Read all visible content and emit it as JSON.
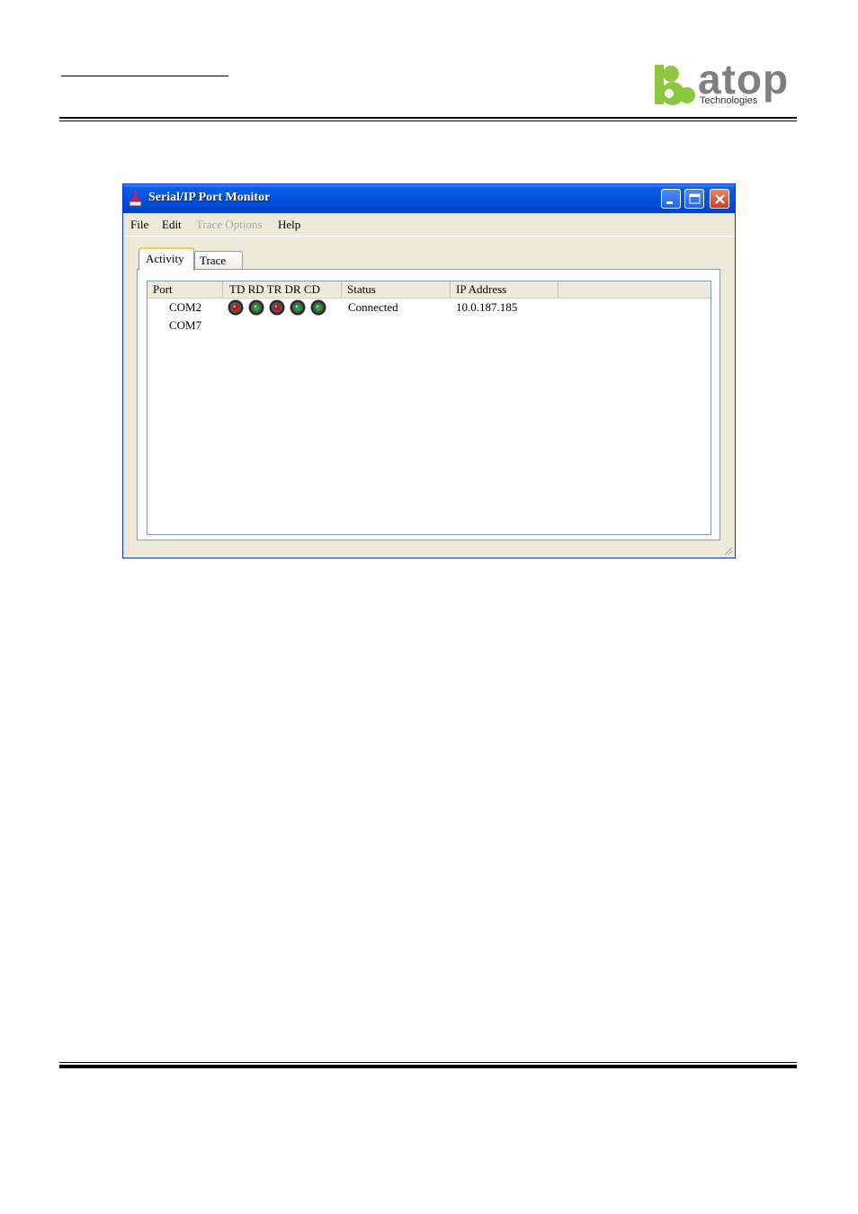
{
  "logo": {
    "word": "atop",
    "subtitle": "Technologies"
  },
  "window": {
    "title": "Serial/IP Port Monitor",
    "menu": [
      {
        "label": "File",
        "enabled": true
      },
      {
        "label": "Edit",
        "enabled": true
      },
      {
        "label": "Trace Options",
        "enabled": false
      },
      {
        "label": "Help",
        "enabled": true
      }
    ],
    "tabs": [
      {
        "label": "Activity",
        "selected": true
      },
      {
        "label": "Trace",
        "selected": false
      }
    ],
    "columns": [
      "Port",
      "TD RD TR DR CD",
      "Status",
      "IP Address",
      ""
    ],
    "rows": [
      {
        "port": "COM2",
        "leds": [
          "red",
          "green",
          "red",
          "green",
          "green"
        ],
        "status": "Connected",
        "ip": "10.0.187.185"
      },
      {
        "port": "COM7",
        "leds": [],
        "status": "",
        "ip": ""
      }
    ]
  },
  "colors": {
    "led_red": "#c81010",
    "led_green": "#10b030",
    "titlebar": "#0153dc",
    "logo_green": "#8dc63f",
    "logo_gray": "#7f7f7f"
  }
}
